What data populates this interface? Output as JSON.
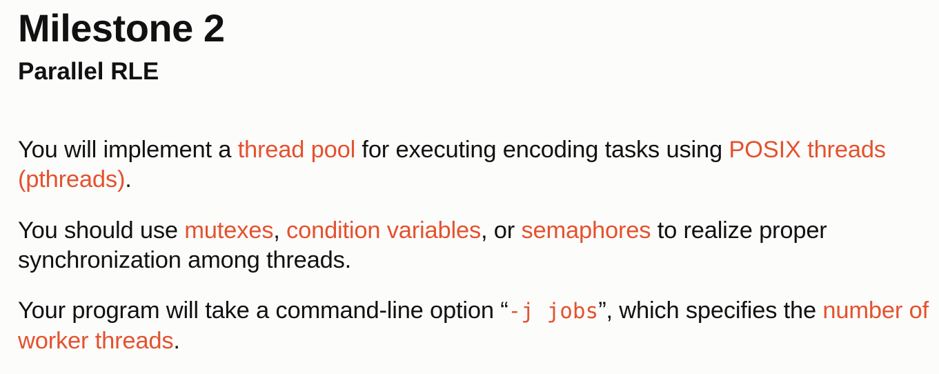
{
  "title": "Milestone 2",
  "subtitle": "Parallel RLE",
  "colors": {
    "background": "#fcfcfb",
    "text": "#111111",
    "highlight": "#e4522e"
  },
  "paragraphs": {
    "p1": {
      "t1": "You will implement a ",
      "h1": "thread pool",
      "t2": " for executing encoding tasks using ",
      "h2": "POSIX threads (pthreads)",
      "t3": "."
    },
    "p2": {
      "t1": "You should use ",
      "h1": "mutexes",
      "t2": ", ",
      "h2": "condition variables",
      "t3": ", or ",
      "h3": "semaphores",
      "t4": " to realize proper synchronization among threads."
    },
    "p3": {
      "t1": "Your program will take a command-line option “",
      "code": "-j jobs",
      "t2": "”, which specifies the ",
      "h1": "number of worker threads",
      "t3": "."
    }
  }
}
